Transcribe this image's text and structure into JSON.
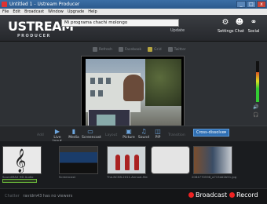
{
  "window": {
    "title": "Untitled 1 - Ustream Producer",
    "controls": [
      "_",
      "□",
      "x"
    ]
  },
  "menu": [
    "File",
    "Edit",
    "Broadcast",
    "Window",
    "Upgrade",
    "Help"
  ],
  "header": {
    "logo": "USTREAM",
    "logo_sub": "PRODUCER",
    "show_title": "Mi programa chachi molongo",
    "update_label": "Update",
    "buttons": [
      {
        "label": "Settings",
        "icon": "gear-icon"
      },
      {
        "label": "Chat",
        "icon": "chat-icon"
      },
      {
        "label": "Social",
        "icon": "social-icon"
      }
    ]
  },
  "overlays": [
    "Refresh",
    "Facebook",
    "Grid",
    "Twitter"
  ],
  "toolbar": {
    "add_label": "Add",
    "layout_label": "Layout",
    "transition_label": "Transition",
    "buttons": [
      "Live Input",
      "Media",
      "Screencast",
      "Picture",
      "Sound",
      "PIP"
    ],
    "transition": "Cross-dissolve"
  },
  "media": [
    {
      "label": "SoundMAX HD Audio",
      "type": "audio"
    },
    {
      "label": "Screencast",
      "type": "screen"
    },
    {
      "label": "The-NCSB-2011-Annual-Merit-Awards-2011-1-EX-Shot",
      "type": "stage"
    },
    {
      "label": "",
      "type": "blank"
    },
    {
      "label": "2084770598_a715dd2b51.jpg",
      "type": "room"
    }
  ],
  "status": {
    "label": "Chatter",
    "text": "ravidm43 has no viewers"
  },
  "actions": {
    "broadcast": "Broadcast",
    "record": "Record"
  }
}
